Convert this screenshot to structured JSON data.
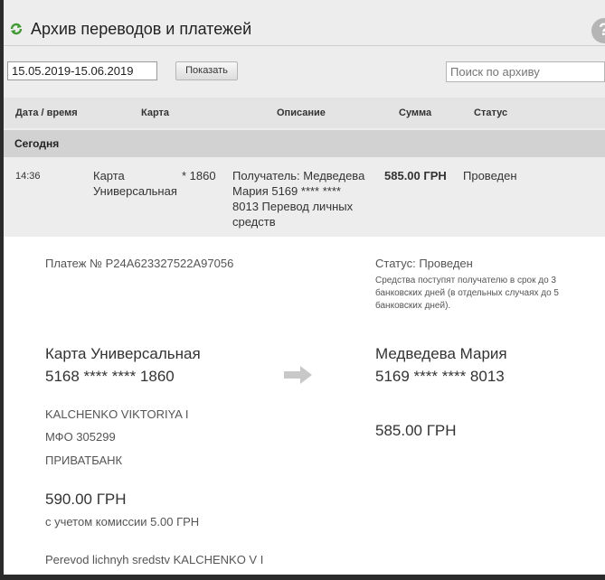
{
  "header": {
    "title": "Архив переводов и платежей",
    "refresh_icon": "refresh-icon",
    "help_icon": "help-icon",
    "help_glyph": "?"
  },
  "filters": {
    "date_range_value": "15.05.2019-15.06.2019",
    "show_button_label": "Показать",
    "search_placeholder": "Поиск по архиву"
  },
  "table": {
    "headers": {
      "datetime": "Дата / время",
      "card": "Карта",
      "description": "Описание",
      "amount": "Сумма",
      "status": "Статус"
    },
    "group_label": "Сегодня",
    "row": {
      "time": "14:36",
      "card_line1": "Карта",
      "card_line2": "Универсальная",
      "card_mask": "* 1860",
      "desc_line1": "Получатель: Медведева",
      "desc_line2": "Мария 5169 **** ****",
      "desc_line3": "8013 Перевод личных",
      "desc_line4": "средств",
      "amount": "585.00 ГРН",
      "status": "Проведен"
    }
  },
  "details": {
    "payment_number": "Платеж № P24A623327522A97056",
    "status": "Статус: Проведен",
    "status_note_line1": "Средства поступят получателю в срок до 3",
    "status_note_line2": "банковских дней (в отдельных случаях до 5",
    "status_note_line3": "банковских дней).",
    "sender_card_name": "Карта Универсальная",
    "sender_card_number": "5168 **** **** 1860",
    "sender_name": "KALCHENKO VIKTORIYA I",
    "sender_mfo": "МФО 305299",
    "sender_bank": "ПРИВАТБАНК",
    "sender_amount": "590.00 ГРН",
    "commission_note": "с учетом комиссии 5.00 ГРН",
    "purpose": "Perevod lichnyh sredstv KALCHENKO V I",
    "arrow_icon": "arrow-right-icon",
    "recipient_name": "Медведева Мария",
    "recipient_card_number": "5169 **** **** 8013",
    "recipient_amount": "585.00 ГРН"
  },
  "colors": {
    "accent_green": "#3f9a32",
    "panel_bg": "#ededed",
    "group_bg": "#d2d2d2",
    "arrow_gray": "#c8c8c8"
  }
}
